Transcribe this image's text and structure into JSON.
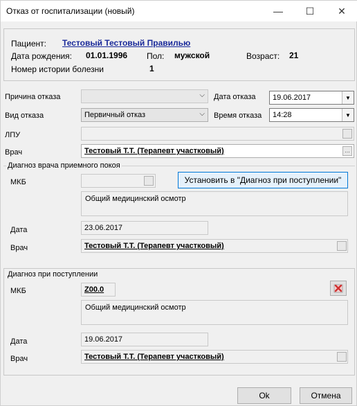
{
  "window": {
    "title": "Отказ от госпитализации (новый)",
    "minimize_label": "—",
    "maximize_label": "☐",
    "close_label": "✕"
  },
  "patient": {
    "patient_label": "Пациент:",
    "patient_name": "Тестовый Тестовый Правилью",
    "birth_label": "Дата рождения:",
    "birth_date": "01.01.1996",
    "sex_label": "Пол:",
    "sex": "мужской",
    "age_label": "Возраст:",
    "age": "21",
    "history_label": "Номер истории болезни",
    "history_number": "1"
  },
  "form": {
    "reason_label": "Причина отказа",
    "reason_value": "",
    "refusal_date_label": "Дата отказа",
    "refusal_date": "19.06.2017",
    "refusal_type_label": "Вид отказа",
    "refusal_type": "Первичный отказ",
    "refusal_time_label": "Время отказа",
    "refusal_time": "14:28",
    "lpu_label": "ЛПУ",
    "lpu_value": "",
    "doctor_label": "Врач",
    "doctor_value": "Тестовый Т.Т. (Терапевт участковый)",
    "ellipsis": "..."
  },
  "admission_diag": {
    "group_title": "Диагноз врача приемного покоя",
    "mkb_label": "МКБ",
    "mkb_value": "",
    "set_button": "Установить в \"Диагноз при поступлении\"",
    "description": "Общий медицинский осмотр",
    "date_label": "Дата",
    "date_value": "23.06.2017",
    "doctor_label": "Врач",
    "doctor_value": "Тестовый Т.Т. (Терапевт участковый)"
  },
  "arrival_diag": {
    "group_title": "Диагноз при поступлении",
    "mkb_label": "МКБ",
    "mkb_value": "Z00.0",
    "description": "Общий медицинский осмотр",
    "date_label": "Дата",
    "date_value": "19.06.2017",
    "doctor_label": "Врач",
    "doctor_value": "Тестовый Т.Т. (Терапевт участковый)"
  },
  "buttons": {
    "ok": "Ok",
    "cancel": "Отмена"
  },
  "colors": {
    "link": "#1a2a9a",
    "delete_icon": "#d03030"
  }
}
